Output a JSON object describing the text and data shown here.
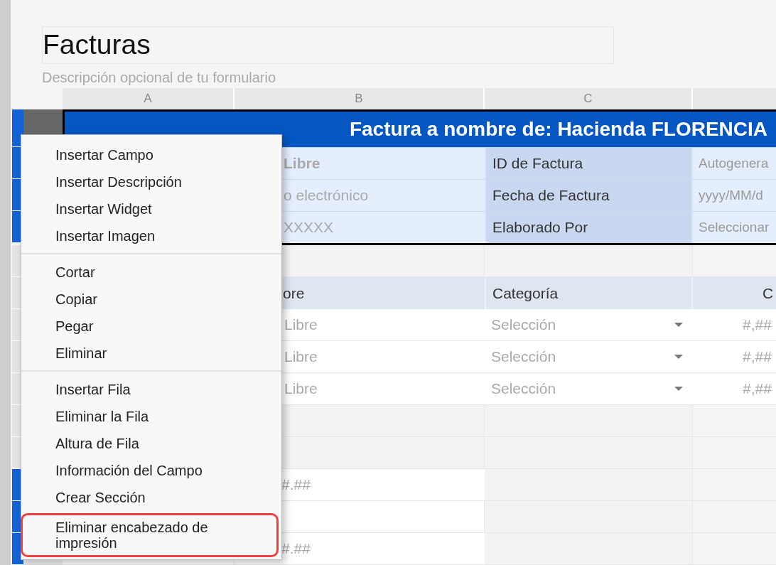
{
  "form": {
    "title": "Facturas",
    "description": "Descripción opcional de tu formulario"
  },
  "columns": [
    "A",
    "B",
    "C"
  ],
  "banner": {
    "text": "Factura a nombre de: Hacienda FLORENCIA",
    "flagged": true
  },
  "info_rows": [
    {
      "column_b": "Libre",
      "bold": true,
      "label": "ID de Factura",
      "column_d": "Autogenera",
      "flagged": true
    },
    {
      "column_b": "o electrónico",
      "bold": false,
      "label": "Fecha de Factura",
      "column_d": "yyyy/MM/d",
      "flagged": true
    },
    {
      "column_b": "XXXXX",
      "bold": false,
      "label": "Elaborado Por",
      "column_d": "Seleccionar",
      "flagged": true
    }
  ],
  "item_table": {
    "headers": [
      "ore",
      "Categoría",
      "C"
    ],
    "rows": [
      {
        "column_b": "Libre",
        "category": "Selección",
        "column_d": "#,##"
      },
      {
        "column_b": "Libre",
        "category": "Selección",
        "column_d": "#,##"
      },
      {
        "column_b": "Libre",
        "category": "Selección",
        "column_d": "#,##"
      }
    ]
  },
  "totals": [
    {
      "column_b": "#.##",
      "flagged": true
    },
    {
      "flagged": true
    },
    {
      "column_b": "#.##",
      "flagged": true
    }
  ],
  "context_menu": {
    "groups": [
      [
        {
          "label": "Insertar Campo",
          "highlighted": false
        },
        {
          "label": "Insertar Descripción",
          "highlighted": false
        },
        {
          "label": "Insertar Widget",
          "highlighted": false
        },
        {
          "label": "Insertar Imagen",
          "highlighted": false
        }
      ],
      [
        {
          "label": "Cortar",
          "highlighted": false
        },
        {
          "label": "Copiar",
          "highlighted": false
        },
        {
          "label": "Pegar",
          "highlighted": false
        },
        {
          "label": "Eliminar",
          "highlighted": false
        }
      ],
      [
        {
          "label": "Insertar Fila",
          "highlighted": false
        },
        {
          "label": "Eliminar la Fila",
          "highlighted": false
        },
        {
          "label": "Altura de Fila",
          "highlighted": false
        },
        {
          "label": "Información del Campo",
          "highlighted": false
        },
        {
          "label": "Crear Sección",
          "highlighted": false
        },
        {
          "label": "Eliminar encabezado de impresión",
          "highlighted": true
        }
      ]
    ]
  }
}
